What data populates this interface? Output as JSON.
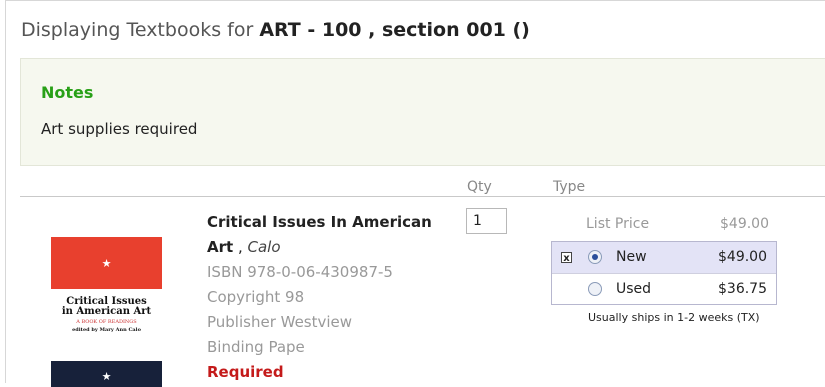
{
  "header": {
    "prefix": "Displaying Textbooks for",
    "course": "ART - 100 , section 001 ()"
  },
  "notes": {
    "title": "Notes",
    "text": "Art supplies required"
  },
  "columns": {
    "qty": "Qty",
    "type": "Type"
  },
  "book": {
    "title": "Critical Issues In American Art",
    "author_sep": " , ",
    "author": "Calo",
    "isbn": "ISBN 978-0-06-430987-5",
    "copyright": "Copyright 98",
    "publisher": "Publisher Westview",
    "binding": "Binding Pape",
    "status": "Required",
    "cover": {
      "star": "★",
      "line1": "Critical Issues",
      "line2": "in American Art",
      "line3": "A BOOK OF READINGS",
      "line4": "edited by Mary Ann Calo"
    }
  },
  "qty_value": "1",
  "pricing": {
    "list_label": "List Price",
    "list_price": "$49.00",
    "options": [
      {
        "label": "New",
        "price": "$49.00",
        "selected": true
      },
      {
        "label": "Used",
        "price": "$36.75",
        "selected": false
      }
    ],
    "remove_glyph": "x",
    "ships_note": "Usually ships in 1-2 weeks (TX)"
  }
}
